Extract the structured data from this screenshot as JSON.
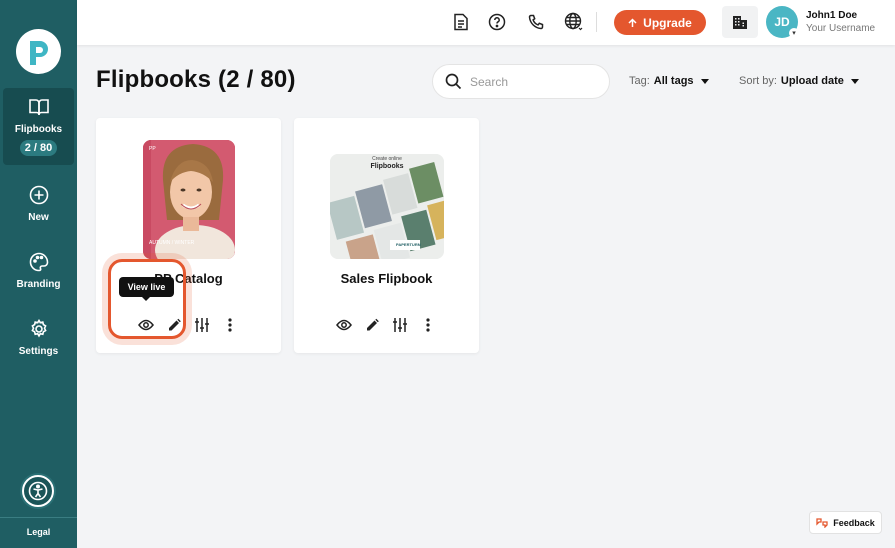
{
  "sidebar": {
    "items": [
      {
        "label": "Flipbooks",
        "badge": "2 / 80"
      },
      {
        "label": "New"
      },
      {
        "label": "Branding"
      },
      {
        "label": "Settings"
      }
    ],
    "legal": "Legal"
  },
  "header": {
    "upgrade_label": "Upgrade",
    "avatar_initials": "JD",
    "user_name": "John1 Doe",
    "user_subtitle": "Your Username"
  },
  "page": {
    "title": "Flipbooks (2 / 80)",
    "search_placeholder": "Search",
    "tag_label": "Tag:",
    "tag_value": "All tags",
    "sort_label": "Sort by:",
    "sort_value": "Upload date"
  },
  "cards": [
    {
      "title": "PP Catalog",
      "cover_text": "AUTUMN / WINTER"
    },
    {
      "title": "Sales Flipbook",
      "cover_heading": "Create online",
      "cover_title": "Flipbooks",
      "cover_brand": "PAPERTURN"
    }
  ],
  "tooltip": "View live",
  "feedback_label": "Feedback",
  "colors": {
    "sidebar": "#1f5e63",
    "accent": "#e4572e",
    "avatar": "#4ab6c4"
  }
}
